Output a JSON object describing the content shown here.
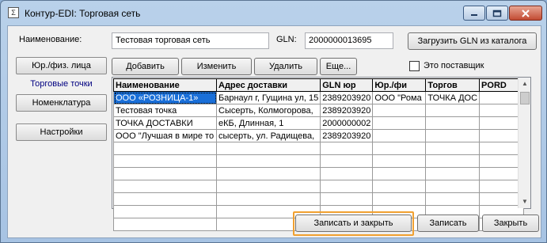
{
  "window": {
    "title": "Контур-EDI: Торговая сеть",
    "app_icon_glyph": "Σ"
  },
  "form": {
    "name_label": "Наименование:",
    "name_value": "Тестовая торговая сеть",
    "gln_label": "GLN:",
    "gln_value": "2000000013695",
    "load_gln_button": "Загрузить GLN из каталога",
    "supplier_checkbox_label": "Это поставщик"
  },
  "sidebar": {
    "items": [
      {
        "label": "Юр./физ. лица"
      },
      {
        "label": "Торговые точки"
      },
      {
        "label": "Номенклатура"
      },
      {
        "label": "Настройки"
      }
    ]
  },
  "toolbar": {
    "add": "Добавить",
    "edit": "Изменить",
    "delete": "Удалить",
    "more": "Еще..."
  },
  "table": {
    "columns": [
      "Наименование",
      "Адрес доставки",
      "GLN юр",
      "Юр./фи",
      "Торгов",
      "PORD"
    ],
    "rows": [
      [
        "ООО «РОЗНИЦА-1»",
        "Барнаул г, Гущина ул, 15",
        "2389203920",
        "ООО \"Рома",
        "ТОЧКА ДОС",
        ""
      ],
      [
        "Тестовая точка",
        "Сысерть, Колмогорова,",
        "2389203920",
        "",
        "",
        ""
      ],
      [
        "ТОЧКА ДОСТАВКИ",
        "еКБ, Длинная, 1",
        "2000000002",
        "",
        "",
        ""
      ],
      [
        "ООО \"Лучшая в мире то",
        "сысерть, ул. Радищева,",
        "2389203920",
        "",
        "",
        ""
      ]
    ],
    "empty_rows": 7
  },
  "footer": {
    "save_close": "Записать и закрыть",
    "save": "Записать",
    "close": "Закрыть"
  },
  "colors": {
    "selection": "#1a6fd8",
    "highlight": "#f0a030"
  }
}
